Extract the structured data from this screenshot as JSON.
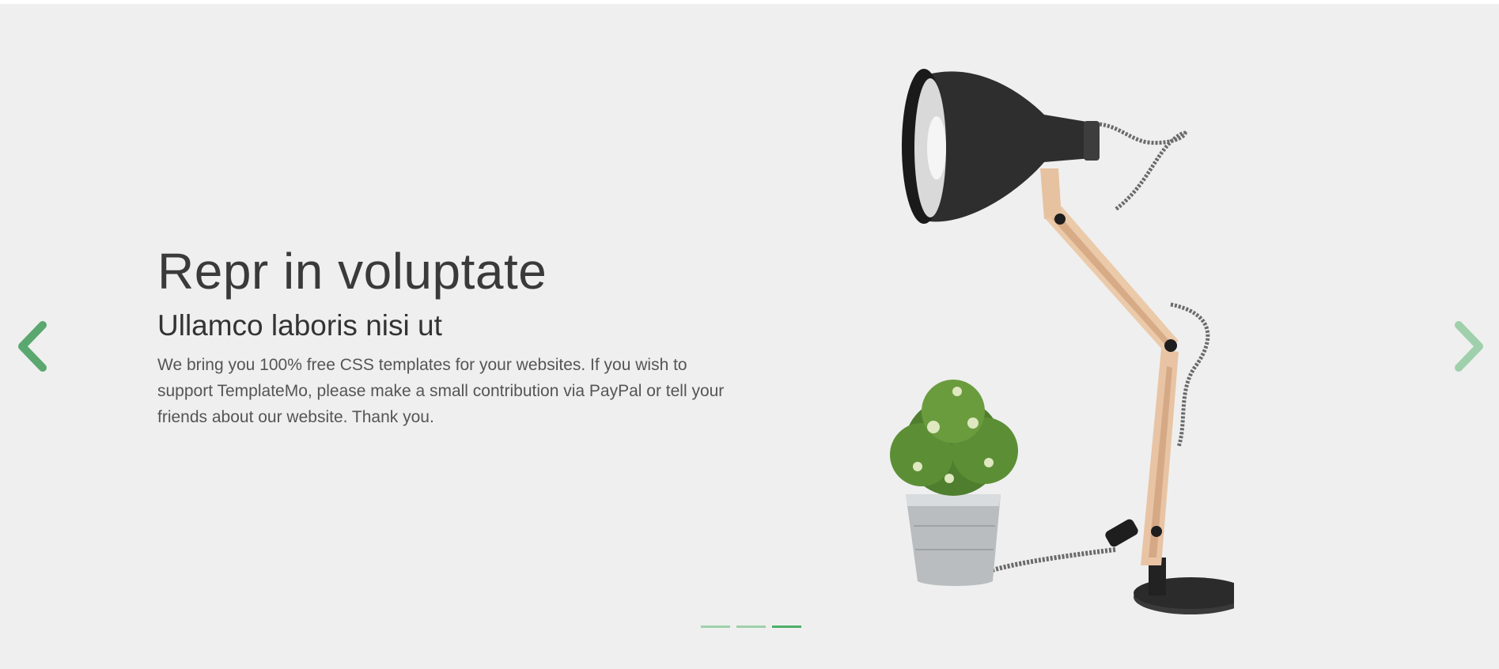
{
  "slide": {
    "title": "Repr in voluptate",
    "subtitle": "Ullamco laboris nisi ut",
    "body": "We bring you 100% free CSS templates for your websites. If you wish to support TemplateMo, please make a small contribution via PayPal or tell your friends about our website. Thank you."
  },
  "controls": {
    "prev_icon": "chevron-left-icon",
    "next_icon": "chevron-right-icon",
    "indicator_count": 3,
    "active_indicator": 3
  },
  "colors": {
    "background": "#efefef",
    "accent": "#4caf68",
    "accent_light": "#9fd0ab",
    "text_dark": "#3a3a3a"
  },
  "image": {
    "subject": "desk-lamp-with-potted-plant"
  }
}
